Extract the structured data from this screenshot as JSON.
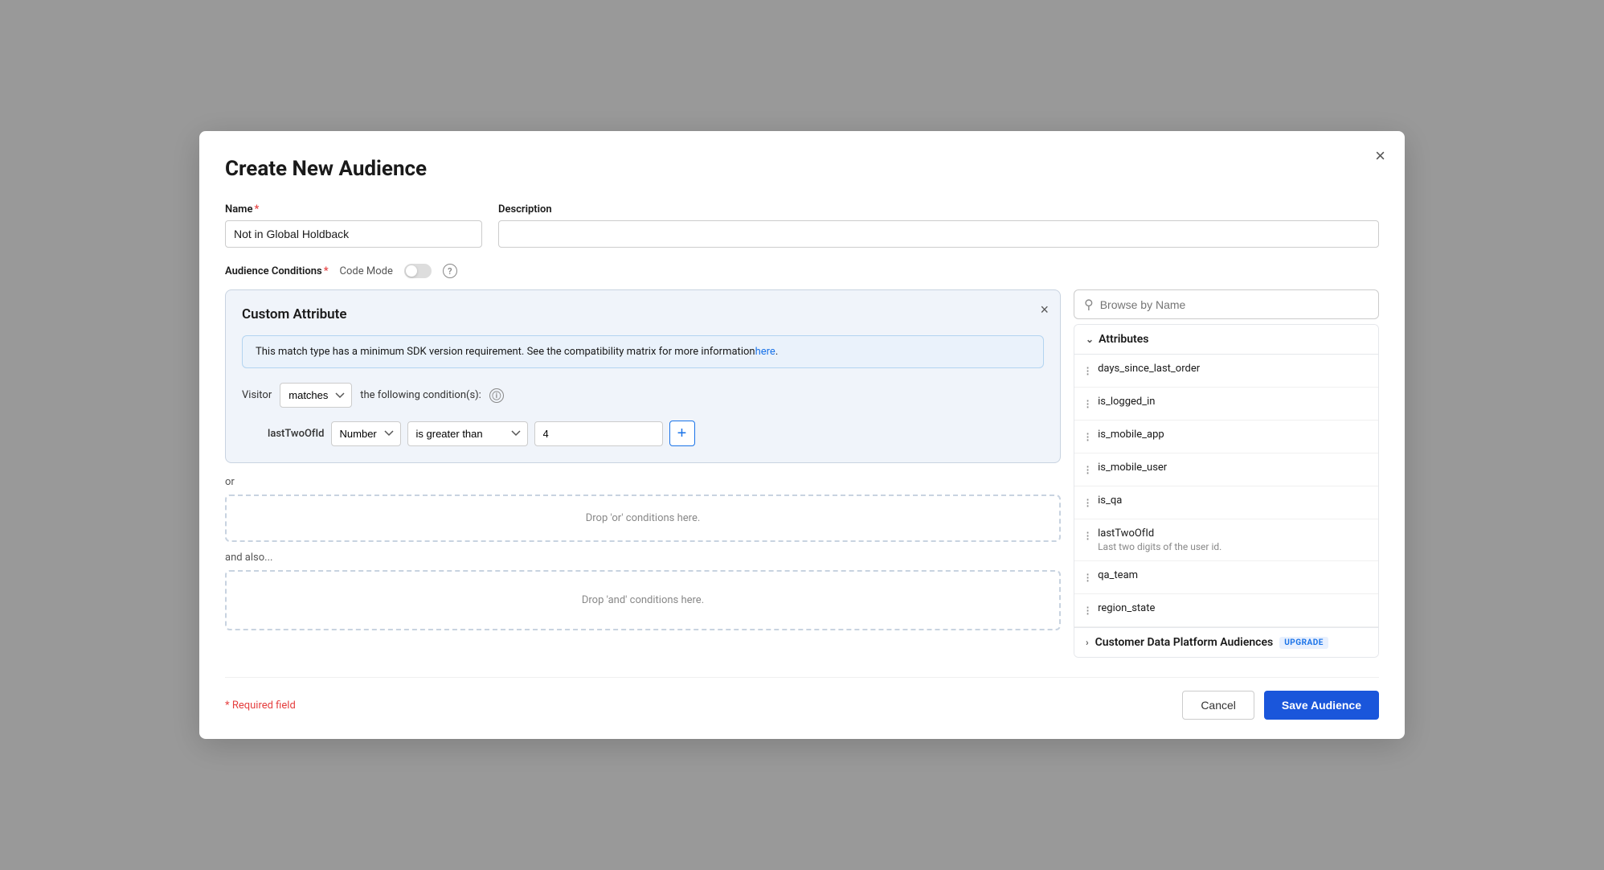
{
  "modal": {
    "title": "Create New Audience",
    "close_label": "×"
  },
  "form": {
    "name_label": "Name",
    "name_required": "*",
    "name_value": "Not in Global Holdback",
    "description_label": "Description",
    "description_value": "",
    "description_placeholder": ""
  },
  "audience_conditions": {
    "label": "Audience Conditions",
    "required_star": "*",
    "code_mode_label": "Code Mode",
    "help_icon": "?"
  },
  "custom_attribute": {
    "title": "Custom Attribute",
    "close_label": "×",
    "sdk_notice": "This match type has a minimum SDK version requirement. See the compatibility matrix for more information",
    "sdk_link_text": "here",
    "visitor_label": "Visitor",
    "matches_option": "matches",
    "condition_suffix": "the following condition(s):",
    "info_icon": "ⓘ",
    "attribute_name": "lastTwoOfId",
    "type_option": "Number",
    "operator_option": "is greater than",
    "value": "4",
    "add_btn_label": "+",
    "or_label": "or",
    "drop_or_label": "Drop 'or' conditions here.",
    "and_also_label": "and also...",
    "drop_and_label": "Drop 'and' conditions here."
  },
  "sidebar": {
    "search_placeholder": "Browse by Name",
    "attributes_label": "Attributes",
    "attributes": [
      {
        "name": "days_since_last_order",
        "desc": ""
      },
      {
        "name": "is_logged_in",
        "desc": ""
      },
      {
        "name": "is_mobile_app",
        "desc": ""
      },
      {
        "name": "is_mobile_user",
        "desc": ""
      },
      {
        "name": "is_qa",
        "desc": ""
      },
      {
        "name": "lastTwoOfId",
        "desc": "Last two digits of the user id."
      },
      {
        "name": "qa_team",
        "desc": ""
      },
      {
        "name": "region_state",
        "desc": ""
      }
    ],
    "cdp_label": "Customer Data Platform Audiences",
    "upgrade_label": "UPGRADE"
  },
  "footer": {
    "required_text": "* Required field",
    "cancel_label": "Cancel",
    "save_label": "Save Audience"
  },
  "colors": {
    "accent": "#1a56db",
    "danger": "#e53e3e"
  }
}
